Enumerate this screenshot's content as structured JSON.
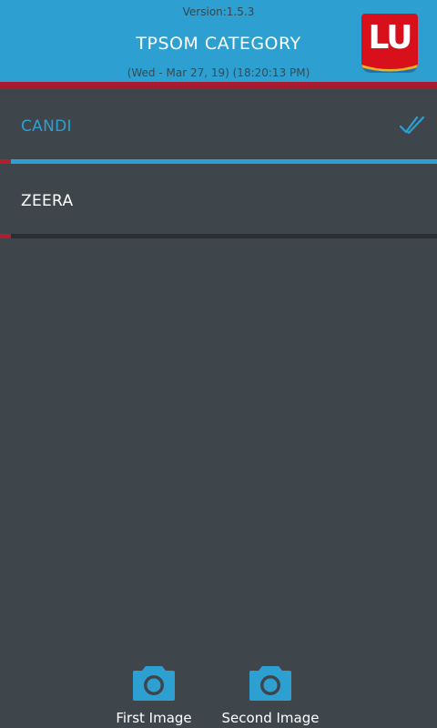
{
  "header": {
    "version": "Version:1.5.3",
    "title": "TPSOM CATEGORY",
    "datetime": "(Wed - Mar 27, 19) (18:20:13 PM)",
    "logo_text": "LU"
  },
  "categories": [
    {
      "label": "CANDI",
      "selected": true
    },
    {
      "label": "ZEERA",
      "selected": false
    }
  ],
  "footer": {
    "first_image_label": "First Image",
    "second_image_label": "Second Image"
  },
  "colors": {
    "accent": "#2d9fd0",
    "brand_red": "#a61b2d",
    "background": "#3f464b"
  },
  "icons": {
    "selected": "double-check-icon",
    "capture": "camera-icon",
    "logo": "lu-logo"
  }
}
